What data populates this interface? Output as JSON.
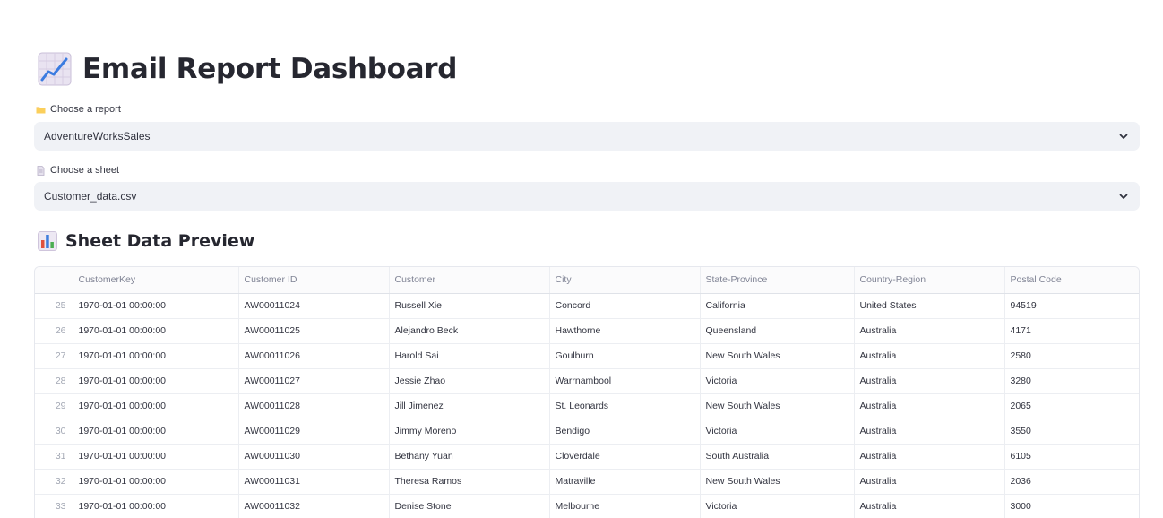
{
  "header": {
    "title": "Email Report Dashboard",
    "icon": "chart-increasing-icon"
  },
  "report_select": {
    "label": "Choose a report",
    "label_icon": "folder-icon",
    "value": "AdventureWorksSales"
  },
  "sheet_select": {
    "label": "Choose a sheet",
    "label_icon": "page-icon",
    "value": "Customer_data.csv"
  },
  "preview": {
    "title": "Sheet Data Preview",
    "icon": "bar-chart-icon"
  },
  "table": {
    "columns": [
      "CustomerKey",
      "Customer ID",
      "Customer",
      "City",
      "State-Province",
      "Country-Region",
      "Postal Code"
    ],
    "rows": [
      {
        "idx": "25",
        "cells": [
          "1970-01-01 00:00:00",
          "AW00011024",
          "Russell Xie",
          "Concord",
          "California",
          "United States",
          "94519"
        ]
      },
      {
        "idx": "26",
        "cells": [
          "1970-01-01 00:00:00",
          "AW00011025",
          "Alejandro Beck",
          "Hawthorne",
          "Queensland",
          "Australia",
          "4171"
        ]
      },
      {
        "idx": "27",
        "cells": [
          "1970-01-01 00:00:00",
          "AW00011026",
          "Harold Sai",
          "Goulburn",
          "New South Wales",
          "Australia",
          "2580"
        ]
      },
      {
        "idx": "28",
        "cells": [
          "1970-01-01 00:00:00",
          "AW00011027",
          "Jessie Zhao",
          "Warrnambool",
          "Victoria",
          "Australia",
          "3280"
        ]
      },
      {
        "idx": "29",
        "cells": [
          "1970-01-01 00:00:00",
          "AW00011028",
          "Jill Jimenez",
          "St. Leonards",
          "New South Wales",
          "Australia",
          "2065"
        ]
      },
      {
        "idx": "30",
        "cells": [
          "1970-01-01 00:00:00",
          "AW00011029",
          "Jimmy Moreno",
          "Bendigo",
          "Victoria",
          "Australia",
          "3550"
        ]
      },
      {
        "idx": "31",
        "cells": [
          "1970-01-01 00:00:00",
          "AW00011030",
          "Bethany Yuan",
          "Cloverdale",
          "South Australia",
          "Australia",
          "6105"
        ]
      },
      {
        "idx": "32",
        "cells": [
          "1970-01-01 00:00:00",
          "AW00011031",
          "Theresa Ramos",
          "Matraville",
          "New South Wales",
          "Australia",
          "2036"
        ]
      },
      {
        "idx": "33",
        "cells": [
          "1970-01-01 00:00:00",
          "AW00011032",
          "Denise Stone",
          "Melbourne",
          "Victoria",
          "Australia",
          "3000"
        ]
      }
    ]
  }
}
